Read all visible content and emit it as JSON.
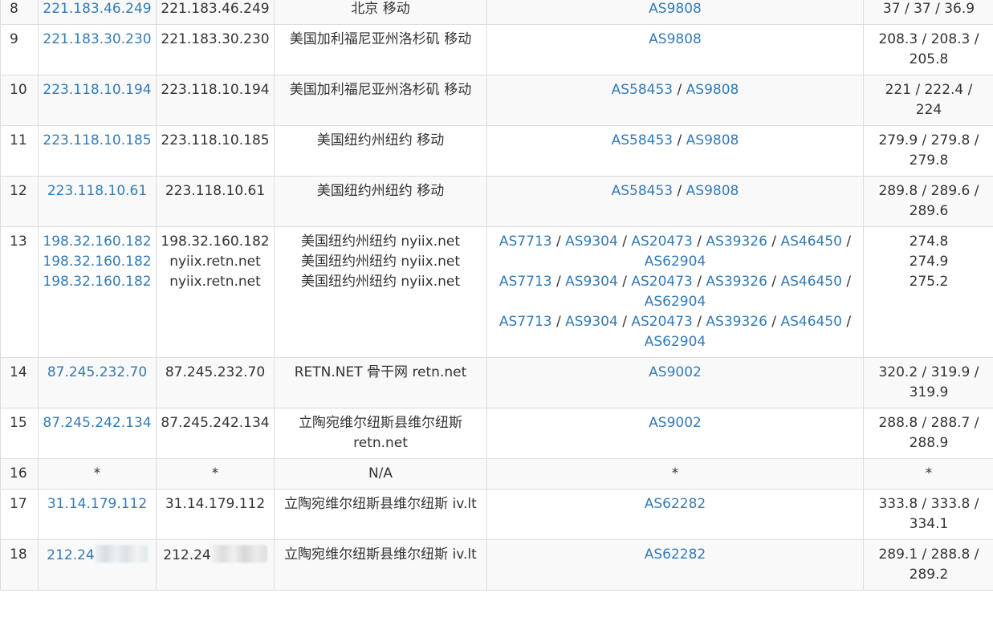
{
  "rows": [
    {
      "hop": "8",
      "ip": "221.183.46.249",
      "host": "221.183.46.249",
      "location": "北京 移动",
      "asn": [
        [
          "AS9808"
        ]
      ],
      "rtt": "37 / 37 / 36.9"
    },
    {
      "hop": "9",
      "ip": "221.183.30.230",
      "host": "221.183.30.230",
      "location": "美国加利福尼亚州洛杉矶 移动",
      "asn": [
        [
          "AS9808"
        ]
      ],
      "rtt": "208.3 / 208.3 / 205.8"
    },
    {
      "hop": "10",
      "ip": "223.118.10.194",
      "host": "223.118.10.194",
      "location": "美国加利福尼亚州洛杉矶 移动",
      "asn": [
        [
          "AS58453",
          "AS9808"
        ]
      ],
      "rtt": "221 / 222.4 / 224"
    },
    {
      "hop": "11",
      "ip": "223.118.10.185",
      "host": "223.118.10.185",
      "location": "美国纽约州纽约 移动",
      "asn": [
        [
          "AS58453",
          "AS9808"
        ]
      ],
      "rtt": "279.9 / 279.8 / 279.8"
    },
    {
      "hop": "12",
      "ip": "223.118.10.61",
      "host": "223.118.10.61",
      "location": "美国纽约州纽约 移动",
      "asn": [
        [
          "AS58453",
          "AS9808"
        ]
      ],
      "rtt": "289.8 / 289.6 / 289.6"
    },
    {
      "hop": "13",
      "ips": [
        "198.32.160.182",
        "198.32.160.182",
        "198.32.160.182"
      ],
      "hosts": [
        "198.32.160.182",
        "nyiix.retn.net",
        "nyiix.retn.net"
      ],
      "locations": [
        "美国纽约州纽约 nyiix.net",
        "美国纽约州纽约 nyiix.net",
        "美国纽约州纽约 nyiix.net"
      ],
      "asn": [
        [
          "AS7713",
          "AS9304",
          "AS20473",
          "AS39326",
          "AS46450",
          "AS62904"
        ],
        [
          "AS7713",
          "AS9304",
          "AS20473",
          "AS39326",
          "AS46450",
          "AS62904"
        ],
        [
          "AS7713",
          "AS9304",
          "AS20473",
          "AS39326",
          "AS46450",
          "AS62904"
        ]
      ],
      "rtts": [
        "274.8",
        "274.9",
        "275.2"
      ]
    },
    {
      "hop": "14",
      "ip": "87.245.232.70",
      "host": "87.245.232.70",
      "location": "RETN.NET 骨干网 retn.net",
      "asn": [
        [
          "AS9002"
        ]
      ],
      "rtt": "320.2 / 319.9 / 319.9"
    },
    {
      "hop": "15",
      "ip": "87.245.242.134",
      "host": "87.245.242.134",
      "location": "立陶宛维尔纽斯县维尔纽斯 retn.net",
      "asn": [
        [
          "AS9002"
        ]
      ],
      "rtt": "288.8 / 288.7 / 288.9"
    },
    {
      "hop": "16",
      "ip": "*",
      "host": "*",
      "location": "N/A",
      "asn_text": "*",
      "rtt": "*"
    },
    {
      "hop": "17",
      "ip": "31.14.179.112",
      "host": "31.14.179.112",
      "location": "立陶宛维尔纽斯县维尔纽斯 iv.lt",
      "asn": [
        [
          "AS62282"
        ]
      ],
      "rtt": "333.8 / 333.8 / 334.1"
    },
    {
      "hop": "18",
      "ip": "212.24",
      "host": "212.24",
      "redacted": true,
      "location": "立陶宛维尔纽斯县维尔纽斯 iv.lt",
      "asn": [
        [
          "AS62282"
        ]
      ],
      "rtt": "289.1 / 288.8 / 289.2"
    }
  ],
  "asn_separator": " / ",
  "colors": {
    "link": "#337ab7",
    "border": "#dddddd",
    "stripe": "#f9f9f9",
    "text": "#333333"
  }
}
